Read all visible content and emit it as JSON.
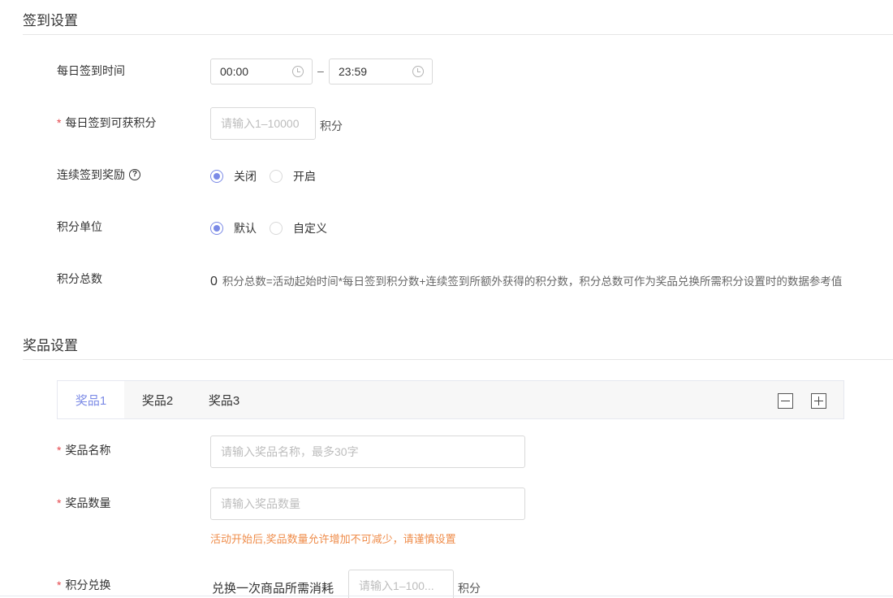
{
  "checkin_section": {
    "title": "签到设置",
    "daily_time": {
      "label": "每日签到时间",
      "start": "00:00",
      "separator": "–",
      "end": "23:59"
    },
    "daily_points": {
      "required_mark": "*",
      "label": "每日签到可获积分",
      "placeholder": "请输入1–10000",
      "unit": "积分"
    },
    "streak_reward": {
      "label": "连续签到奖励",
      "help_glyph": "?",
      "options": [
        "关闭",
        "开启"
      ],
      "selected": "关闭"
    },
    "point_unit": {
      "label": "积分单位",
      "options": [
        "默认",
        "自定义"
      ],
      "selected": "默认"
    },
    "total_points": {
      "label": "积分总数",
      "value": "0",
      "description": "积分总数=活动起始时间*每日签到积分数+连续签到所额外获得的积分数，积分总数可作为奖品兑换所需积分设置时的数据参考值"
    }
  },
  "prize_section": {
    "title": "奖品设置",
    "tabs": [
      "奖品1",
      "奖品2",
      "奖品3"
    ],
    "active_tab": "奖品1",
    "prize_name": {
      "required_mark": "*",
      "label": "奖品名称",
      "placeholder": "请输入奖品名称，最多30字"
    },
    "prize_quantity": {
      "required_mark": "*",
      "label": "奖品数量",
      "placeholder": "请输入奖品数量",
      "hint": "活动开始后,奖品数量允许增加不可减少，请谨慎设置"
    },
    "points_exchange": {
      "required_mark": "*",
      "label": "积分兑换",
      "prefix": "兑换一次商品所需消耗",
      "placeholder": "请输入1–100...",
      "unit": "积分"
    }
  },
  "colors": {
    "accent": "#7b8ae6",
    "required": "#e5484d",
    "hint": "#ef8c4a"
  }
}
